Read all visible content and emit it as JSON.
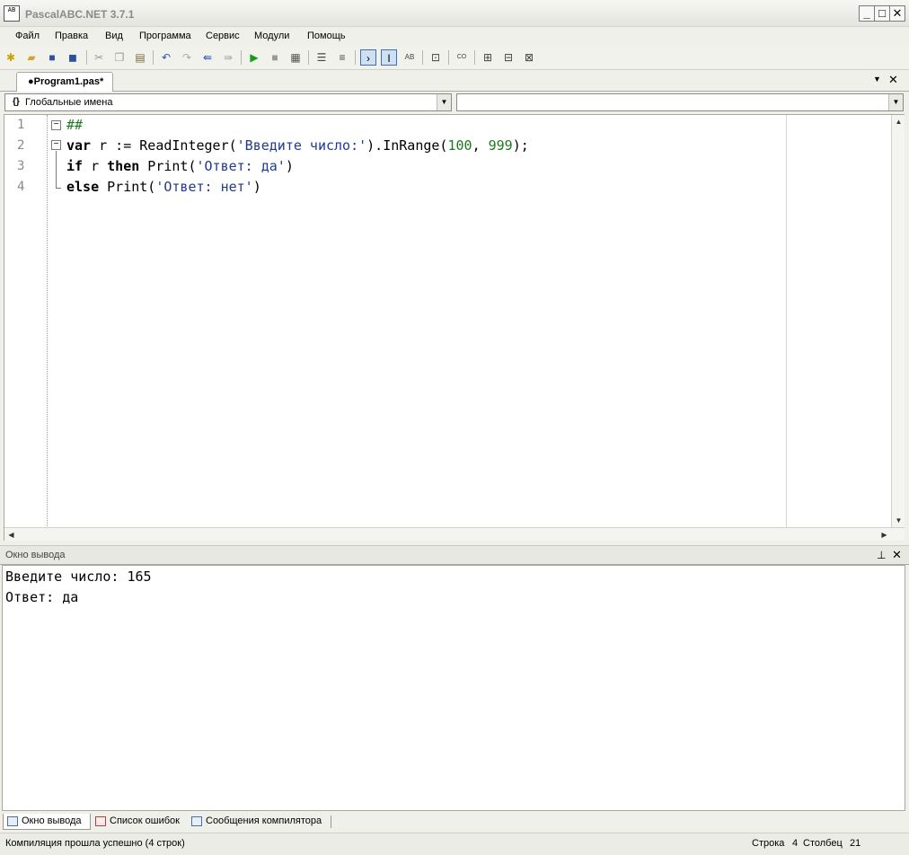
{
  "window": {
    "title": "PascalABC.NET 3.7.1",
    "icon_text": "AB"
  },
  "menu": [
    "Файл",
    "Правка",
    "Вид",
    "Программа",
    "Сервис",
    "Модули",
    "Помощь"
  ],
  "toolbar_icons": [
    "new-file-icon",
    "open-folder-icon",
    "save-icon",
    "save-all-icon",
    "cut-icon",
    "copy-icon",
    "paste-icon",
    "undo-icon",
    "redo-icon",
    "back-icon",
    "forward-icon",
    "run-icon",
    "stop-icon",
    "compile-icon",
    "comment-icon",
    "uncomment-icon",
    "console-icon",
    "text-icon",
    "abc-icon",
    "format-icon",
    "code-icon",
    "debug-step-icon",
    "debug-into-icon",
    "debug-out-icon"
  ],
  "tab": {
    "label": "●Program1.pas*"
  },
  "scope_combo": {
    "value": "Глобальные имена",
    "icon": "{}"
  },
  "member_combo": {
    "value": ""
  },
  "editor": {
    "lines": [
      {
        "no": "1",
        "parts": [
          {
            "c": "cm",
            "t": "##"
          }
        ]
      },
      {
        "no": "2",
        "parts": [
          {
            "c": "kw",
            "t": "var"
          },
          {
            "c": "",
            "t": " r := ReadInteger("
          },
          {
            "c": "str",
            "t": "'Введите число:'"
          },
          {
            "c": "",
            "t": ").InRange("
          },
          {
            "c": "num",
            "t": "100"
          },
          {
            "c": "",
            "t": ", "
          },
          {
            "c": "num",
            "t": "999"
          },
          {
            "c": "",
            "t": ");"
          }
        ]
      },
      {
        "no": "3",
        "parts": [
          {
            "c": "kw",
            "t": "if"
          },
          {
            "c": "",
            "t": " r "
          },
          {
            "c": "kw",
            "t": "then"
          },
          {
            "c": "",
            "t": " Print("
          },
          {
            "c": "str",
            "t": "'Ответ: да'"
          },
          {
            "c": "",
            "t": ")"
          }
        ]
      },
      {
        "no": "4",
        "parts": [
          {
            "c": "kw",
            "t": "else"
          },
          {
            "c": "",
            "t": " Print("
          },
          {
            "c": "str",
            "t": "'Ответ: нет'"
          },
          {
            "c": "",
            "t": ")"
          }
        ]
      }
    ]
  },
  "output_panel": {
    "title": "Окно вывода",
    "lines": [
      "Введите число: 165",
      "Ответ: да"
    ]
  },
  "bottom_tabs": [
    "Окно вывода",
    "Список ошибок",
    "Сообщения компилятора"
  ],
  "status": {
    "message": "Компиляция прошла успешно (4 строк)",
    "row_label": "Строка",
    "row_value": "4",
    "col_label": "Столбец",
    "col_value": "21"
  },
  "colors": {
    "keyword": "#000000",
    "string": "#1f3a8f",
    "number": "#1d7a1d",
    "comment": "#1d7a1d"
  }
}
